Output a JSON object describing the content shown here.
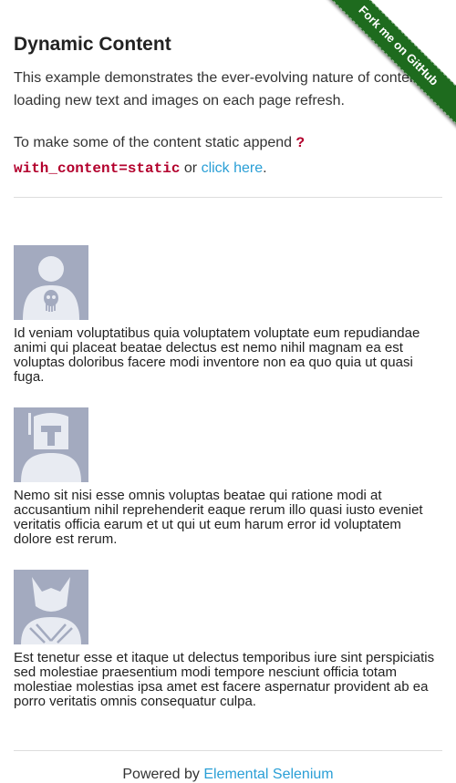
{
  "ribbon": {
    "label": "Fork me on GitHub",
    "color": "#1e6b1e"
  },
  "header": {
    "title": "Dynamic Content"
  },
  "intro": {
    "text": "This example demonstrates the ever-evolving nature of content by loading new text and images on each page refresh."
  },
  "static_note": {
    "prefix": "To make some of the content static append ",
    "code": "?with_content=static",
    "middle": " or ",
    "link": "click here",
    "suffix": "."
  },
  "rows": [
    {
      "icon": "punisher-avatar-icon",
      "text": "Id veniam voluptatibus quia voluptatem voluptate eum repudiandae animi qui placeat beatae delectus est nemo nihil magnam ea est voluptas doloribus facere modi inventore non ea quo quia ut quasi fuga."
    },
    {
      "icon": "boba-fett-avatar-icon",
      "text": "Nemo sit nisi esse omnis voluptas beatae qui ratione modi at accusantium nihil reprehenderit eaque rerum illo quasi iusto eveniet veritatis officia earum et ut qui ut eum harum error id voluptatem dolore est rerum."
    },
    {
      "icon": "wolverine-avatar-icon",
      "text": "Est tenetur esse et itaque ut delectus temporibus iure sint perspiciatis sed molestiae praesentium modi tempore nesciunt officia totam molestiae molestias ipsa amet est facere aspernatur provident ab ea porro veritatis omnis consequatur culpa."
    }
  ],
  "footer": {
    "prefix": "Powered by ",
    "link": "Elemental Selenium"
  },
  "colors": {
    "link": "#2a9fd6",
    "code": "#b3002d",
    "avatar_bg": "#a3aabf",
    "avatar_fg": "#e8ebf2"
  }
}
